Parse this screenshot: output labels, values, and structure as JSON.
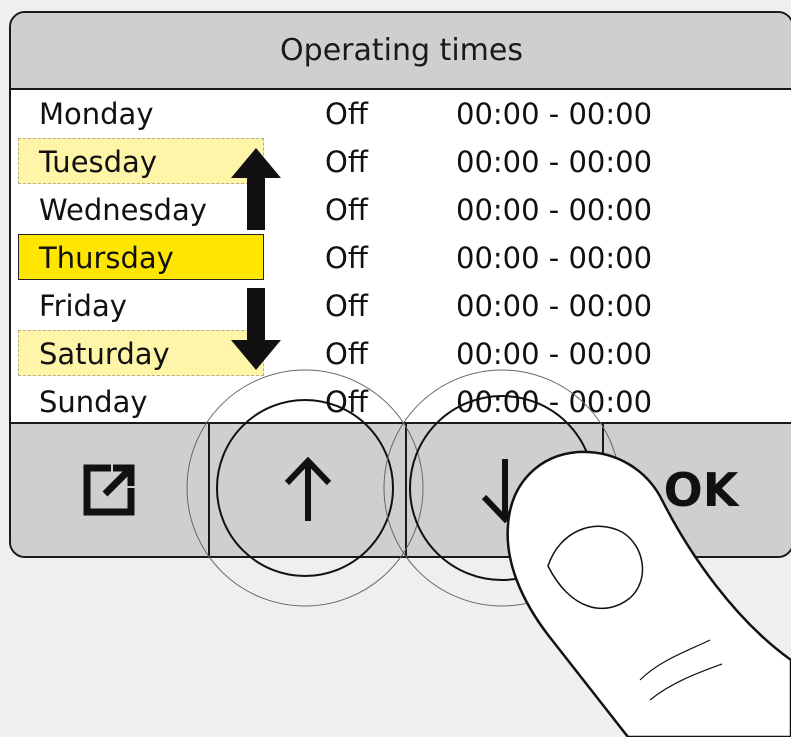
{
  "title": "Operating times",
  "days": [
    {
      "day": "Monday",
      "state": "Off",
      "time": "00:00 - 00:00",
      "highlight": "none"
    },
    {
      "day": "Tuesday",
      "state": "Off",
      "time": "00:00 - 00:00",
      "highlight": "dashed"
    },
    {
      "day": "Wednesday",
      "state": "Off",
      "time": "00:00 - 00:00",
      "highlight": "none"
    },
    {
      "day": "Thursday",
      "state": "Off",
      "time": "00:00 - 00:00",
      "highlight": "selected"
    },
    {
      "day": "Friday",
      "state": "Off",
      "time": "00:00 - 00:00",
      "highlight": "none"
    },
    {
      "day": "Saturday",
      "state": "Off",
      "time": "00:00 - 00:00",
      "highlight": "dashed"
    },
    {
      "day": "Sunday",
      "state": "Off",
      "time": "00:00 - 00:00",
      "highlight": "none"
    }
  ],
  "buttons": {
    "export_icon": "external-link-icon",
    "up_icon": "arrow-up-icon",
    "down_icon": "arrow-down-icon",
    "ok_label": "OK"
  },
  "colors": {
    "selected": "#ffe600",
    "preview": "#fff5a8",
    "bar": "#cfcfcf"
  }
}
